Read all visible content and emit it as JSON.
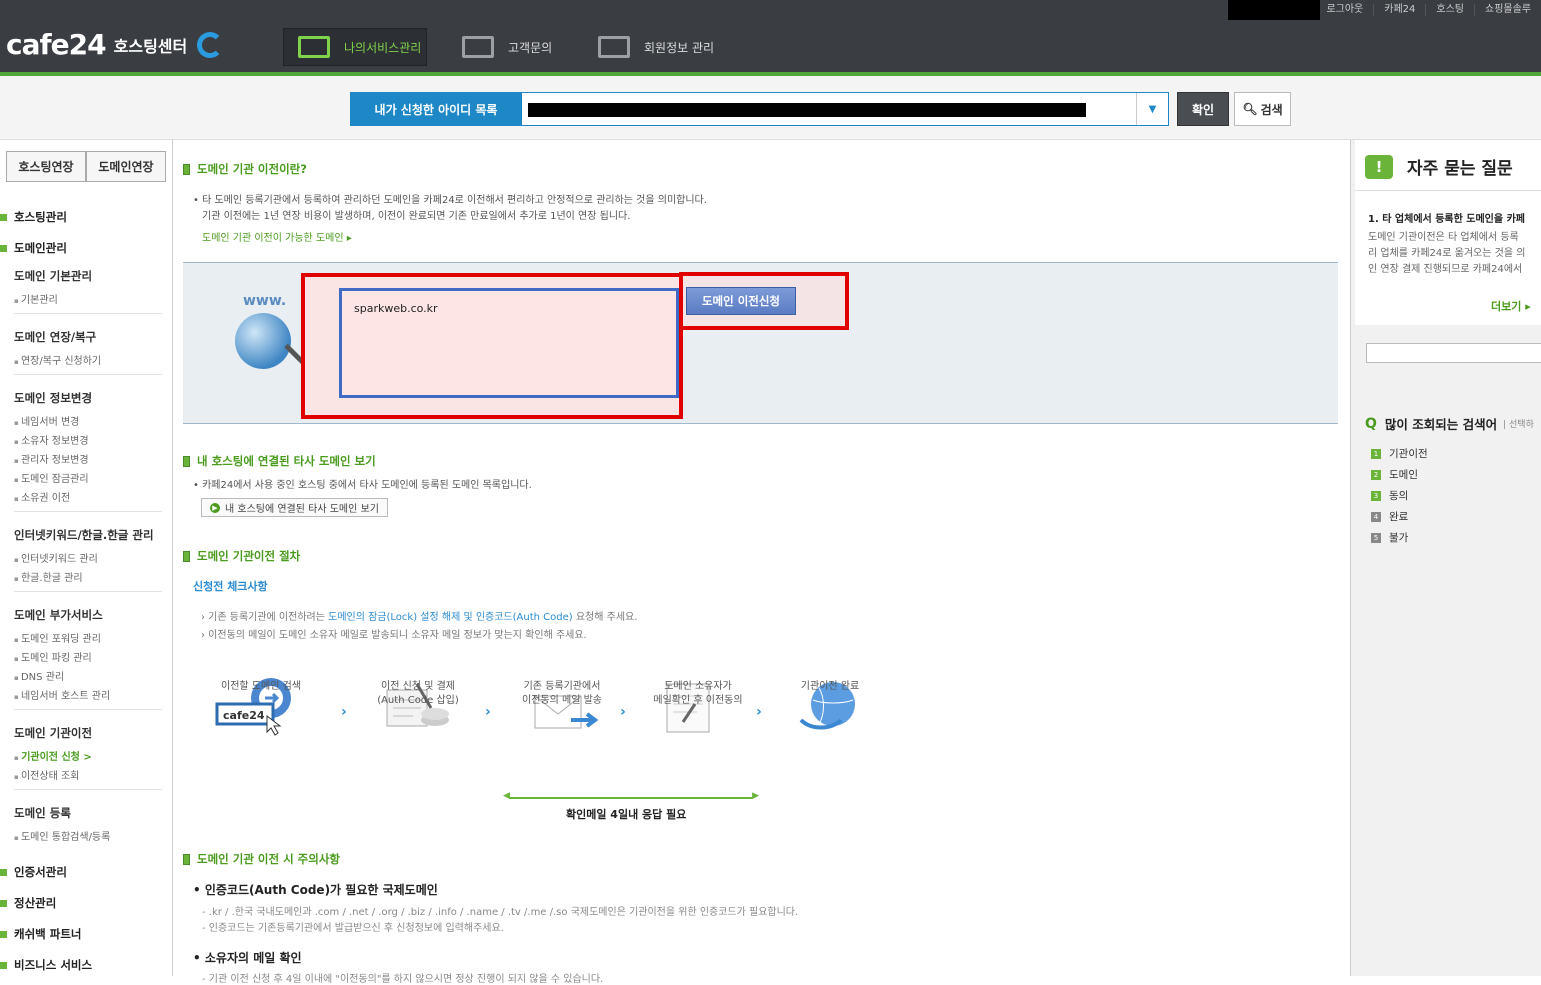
{
  "util": {
    "items": [
      "로그아웃",
      "카페24",
      "호스팅",
      "쇼핑몰솔루"
    ]
  },
  "logo": {
    "brand": "cafe24",
    "sub": "호스팅센터"
  },
  "gnb": [
    {
      "label": "나의서비스관리"
    },
    {
      "label": "고객문의"
    },
    {
      "label": "회원정보 관리"
    }
  ],
  "searchbar": {
    "label": "내가 신청한 아이디 목록",
    "ok": "확인",
    "search": "검색"
  },
  "sidebar": {
    "tabs": [
      "호스팅연장",
      "도메인연장"
    ],
    "cats": {
      "c1": "호스팅관리",
      "c2": "도메인관리",
      "c3": "인증서관리",
      "c4": "정산관리",
      "c5": "캐쉬백 파트너",
      "c6": "비즈니스 서비스"
    },
    "groups": {
      "g1": {
        "title": "도메인 기본관리",
        "items": [
          "기본관리"
        ]
      },
      "g2": {
        "title": "도메인 연장/복구",
        "items": [
          "연장/복구 신청하기"
        ]
      },
      "g3": {
        "title": "도메인 정보변경",
        "items": [
          "네임서버 변경",
          "소유자 정보변경",
          "관리자 정보변경",
          "도메인 잠금관리",
          "소유권 이전"
        ]
      },
      "g4": {
        "title": "인터넷키워드/한글.한글 관리",
        "items": [
          "인터넷키워드 관리",
          "한글.한글 관리"
        ]
      },
      "g5": {
        "title": "도메인 부가서비스",
        "items": [
          "도메인 포워딩 관리",
          "도메인 파킹 관리",
          "DNS 관리",
          "네임서버 호스트 관리"
        ]
      },
      "g6": {
        "title": "도메인 기관이전",
        "items": [
          "기관이전 신청 >",
          "이전상태 조회"
        ]
      },
      "g7": {
        "title": "도메인 등록",
        "items": [
          "도메인 통합검색/등록"
        ]
      }
    }
  },
  "main": {
    "s1": {
      "title": "도메인 기관 이전이란?",
      "line1": "타 도메인 등록기관에서 등록하여 관리하던 도메인을 카페24로 이전해서 편리하고 안정적으로 관리하는 것을 의미합니다.",
      "line2": "기관 이전에는 1년 연장 비용이 발생하며, 이전이 완료되면 기존 만료일에서 추가로 1년이 연장 됩니다.",
      "link": "도메인 기관 이전이 가능한 도메인 ▸"
    },
    "form": {
      "www": "www.",
      "value": "sparkweb.co.kr",
      "button": "도메인 이전신청"
    },
    "s2": {
      "title": "내 호스팅에 연결된 타사 도메인 보기",
      "line": "카페24에서 사용 중인 호스팅 중에서 타사 도메인에 등록된 도메인 목록입니다.",
      "button": "내 호스팅에 연결된 타사 도메인 보기"
    },
    "s3": {
      "title": "도메인 기관이전 절차",
      "sub": "신청전 체크사항",
      "c1a": "› 기존 등록기관에 이전하려는 ",
      "c1b": "도메인의 잠금(Lock) 설정 해제 및 인증코드(Auth Code)",
      "c1c": " 요청해 주세요.",
      "c2": "› 이전동의 메일이 도메인 소유자 메일로 발송되니 소유자 메일 정보가 맞는지 확인해 주세요.",
      "steps": [
        {
          "l1": "이전할 도메인 검색",
          "l2": ""
        },
        {
          "l1": "이전 신청 및 결제",
          "l2": "(Auth Code 삽입)"
        },
        {
          "l1": "기존 등록기관에서",
          "l2": "이전동의 메일 발송"
        },
        {
          "l1": "도메인 소유자가",
          "l2": "메일확인 후 이전동의"
        },
        {
          "l1": "기관이전 완료",
          "l2": ""
        }
      ],
      "arrow": "확인메일 4일내 응답 필요"
    },
    "s4": {
      "title": "도메인 기관 이전 시 주의사항",
      "b1": "인증코드(Auth Code)가 필요한 국제도메인",
      "b1l1": "- .kr / .한국 국내도메인과 .com / .net / .org / .biz / .info / .name / .tv /.me /.so 국제도메인은 기관이전을 위한 인증코드가 필요합니다.",
      "b1l2": "- 인증코드는 기존등록기관에서 발급받으신 후 신청정보에 입력해주세요.",
      "b2": "소유자의 메일 확인",
      "b2l1": "- 기관 이전 신청 후 4일 이내에 \"이전동의\"를 하지 않으시면 정상 진행이 되지 않을 수 있습니다."
    }
  },
  "right": {
    "faq_title": "자주 묻는 질문",
    "faq_q": "1. 타 업체에서 등록한 도메인을 카페",
    "faq_a": [
      "도메인 기관이전은 타 업체에서 등록",
      "리 업체를 카페24로 옮겨오는 것을 의",
      "인 연장 결제 진행되므로 카페24에서"
    ],
    "more": "더보기 ▸",
    "pop_title": "많이 조회되는 검색어",
    "pop_sub": "| 선택하",
    "pop": [
      "기관이전",
      "도메인",
      "동의",
      "완료",
      "불가"
    ]
  },
  "colors": {
    "accent": "#6ab43a",
    "brand_blue": "#1e88c7",
    "highlight_red": "#e00000"
  }
}
